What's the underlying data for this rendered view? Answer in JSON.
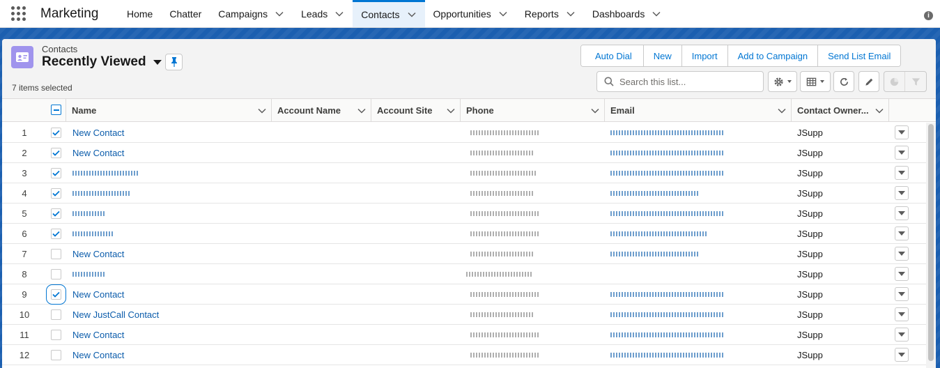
{
  "nav": {
    "app_name": "Marketing",
    "items": [
      {
        "label": "Home",
        "has_menu": false,
        "active": false
      },
      {
        "label": "Chatter",
        "has_menu": false,
        "active": false
      },
      {
        "label": "Campaigns",
        "has_menu": true,
        "active": false
      },
      {
        "label": "Leads",
        "has_menu": true,
        "active": false
      },
      {
        "label": "Contacts",
        "has_menu": true,
        "active": true
      },
      {
        "label": "Opportunities",
        "has_menu": true,
        "active": false
      },
      {
        "label": "Reports",
        "has_menu": true,
        "active": false
      },
      {
        "label": "Dashboards",
        "has_menu": true,
        "active": false
      }
    ],
    "info_glyph": "i"
  },
  "header": {
    "object_label": "Contacts",
    "list_title": "Recently Viewed",
    "selected_count": "7 items selected",
    "actions": [
      "Auto Dial",
      "New",
      "Import",
      "Add to Campaign",
      "Send List Email"
    ],
    "search_placeholder": "Search this list..."
  },
  "table": {
    "columns": [
      "Name",
      "Account Name",
      "Account Site",
      "Phone",
      "Email",
      "Contact Owner..."
    ],
    "rows": [
      {
        "num": "1",
        "checked": true,
        "name": "New Contact",
        "name_redacted": false,
        "phone_redacted": true,
        "email_redacted": true,
        "owner": "JSupp"
      },
      {
        "num": "2",
        "checked": true,
        "name": "New Contact",
        "name_redacted": false,
        "phone_redacted": true,
        "email_redacted": true,
        "owner": "JSupp"
      },
      {
        "num": "3",
        "checked": true,
        "name": "",
        "name_redacted": true,
        "phone_redacted": true,
        "email_redacted": true,
        "owner": "JSupp"
      },
      {
        "num": "4",
        "checked": true,
        "name": "",
        "name_redacted": true,
        "phone_redacted": true,
        "email_redacted": true,
        "owner": "JSupp"
      },
      {
        "num": "5",
        "checked": true,
        "name": "",
        "name_redacted": true,
        "phone_redacted": true,
        "email_redacted": true,
        "owner": "JSupp"
      },
      {
        "num": "6",
        "checked": true,
        "name": "",
        "name_redacted": true,
        "phone_redacted": true,
        "email_redacted": true,
        "owner": "JSupp"
      },
      {
        "num": "7",
        "checked": false,
        "name": "New Contact",
        "name_redacted": false,
        "phone_redacted": true,
        "email_redacted": true,
        "owner": "JSupp"
      },
      {
        "num": "8",
        "checked": false,
        "name": "",
        "name_redacted": true,
        "phone_redacted": true,
        "email_redacted": false,
        "owner": "JSupp"
      },
      {
        "num": "9",
        "checked": true,
        "focused": true,
        "name": "New Contact",
        "name_redacted": false,
        "phone_redacted": true,
        "email_redacted": true,
        "owner": "JSupp"
      },
      {
        "num": "10",
        "checked": false,
        "name": "New JustCall Contact",
        "name_redacted": false,
        "phone_redacted": true,
        "email_redacted": true,
        "owner": "JSupp"
      },
      {
        "num": "11",
        "checked": false,
        "name": "New Contact",
        "name_redacted": false,
        "phone_redacted": true,
        "email_redacted": true,
        "owner": "JSupp"
      },
      {
        "num": "12",
        "checked": false,
        "name": "New Contact",
        "name_redacted": false,
        "phone_redacted": true,
        "email_redacted": true,
        "owner": "JSupp"
      }
    ]
  },
  "colors": {
    "brand_blue": "#0176d3",
    "link_blue": "#0b5cab",
    "band_blue": "#1b5fb0",
    "contact_icon_bg": "#a094ed"
  },
  "icons": {
    "launcher": "waffle-icon",
    "object": "contact-card-icon",
    "pin": "pin-icon",
    "search": "search-icon",
    "settings": "gear-icon",
    "display": "table-view-icon",
    "refresh": "refresh-icon",
    "edit": "pencil-icon",
    "chart": "pie-chart-icon",
    "filter": "filter-icon"
  }
}
